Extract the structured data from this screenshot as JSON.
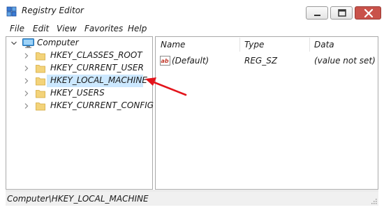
{
  "window": {
    "title": "Registry Editor"
  },
  "menu": {
    "items": [
      "File",
      "Edit",
      "View",
      "Favorites",
      "Help"
    ]
  },
  "tree": {
    "root": "Computer",
    "nodes": [
      "HKEY_CLASSES_ROOT",
      "HKEY_CURRENT_USER",
      "HKEY_LOCAL_MACHINE",
      "HKEY_USERS",
      "HKEY_CURRENT_CONFIG"
    ],
    "selected": "HKEY_LOCAL_MACHINE"
  },
  "list": {
    "columns": [
      "Name",
      "Type",
      "Data"
    ],
    "rows": [
      {
        "name": "(Default)",
        "type": "REG_SZ",
        "data": "(value not set)"
      }
    ]
  },
  "status": {
    "path": "Computer\\HKEY_LOCAL_MACHINE"
  },
  "colors": {
    "selection": "#cce8ff",
    "close_button": "#c9524a",
    "annotation_arrow": "#e3141b",
    "folder": "#f3d37a"
  }
}
